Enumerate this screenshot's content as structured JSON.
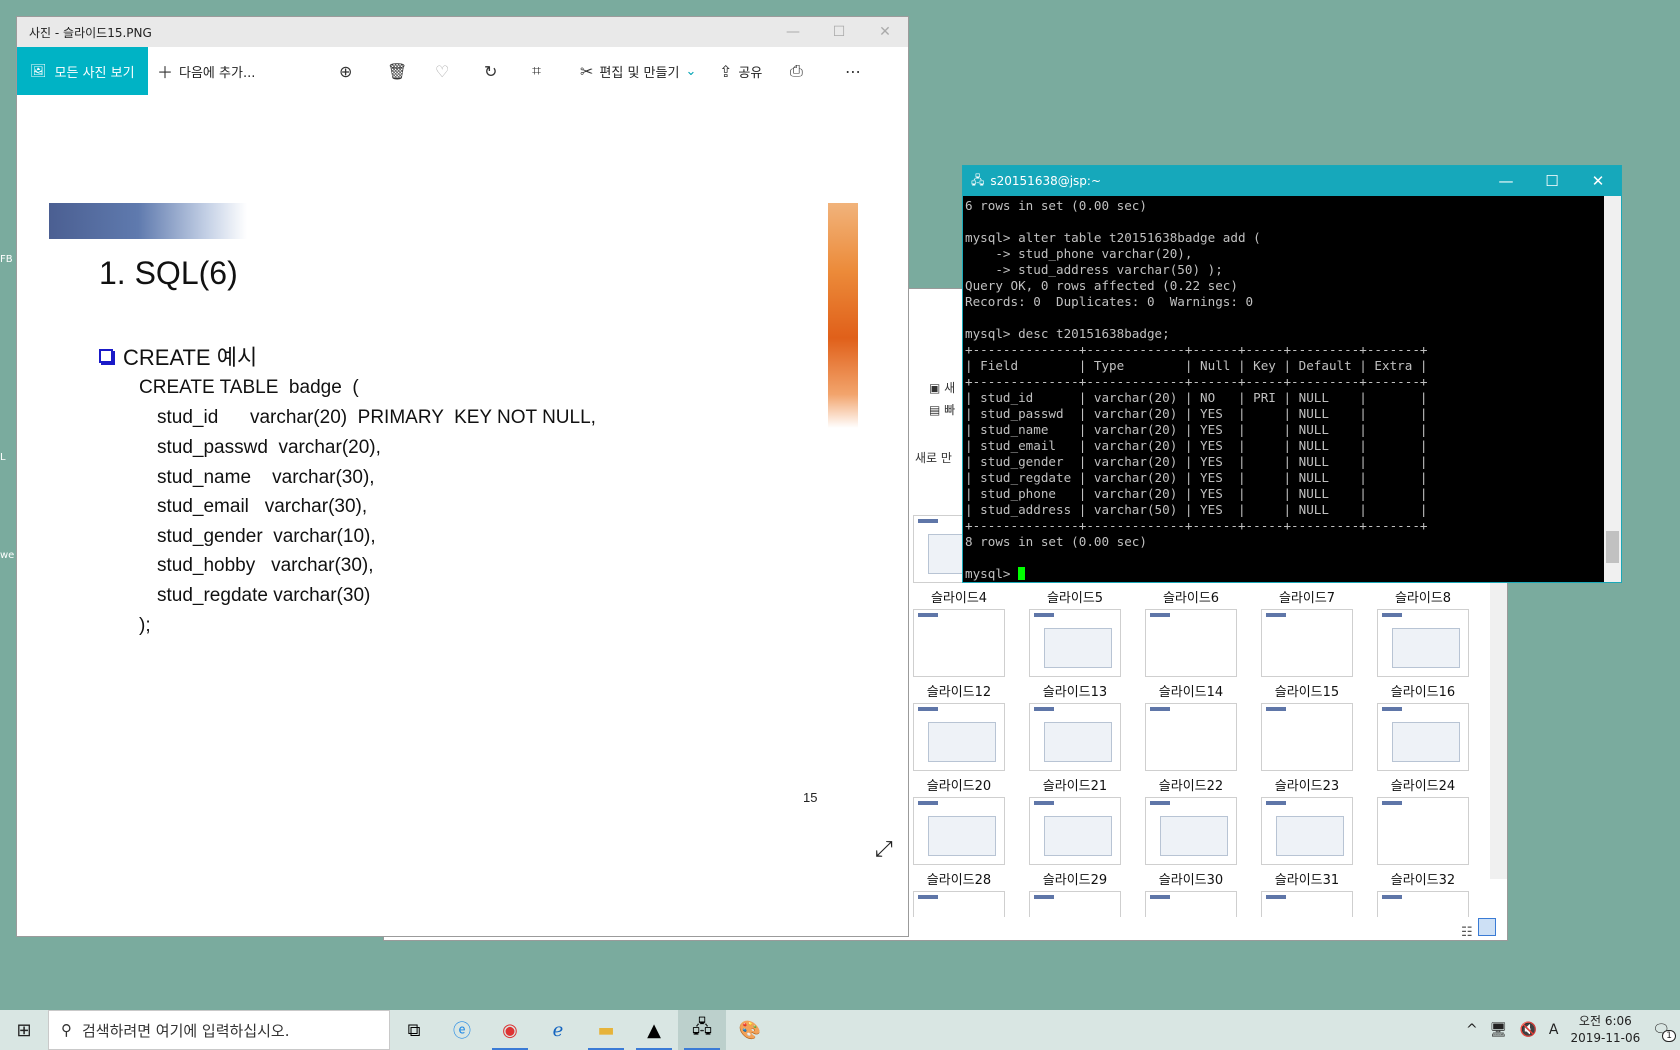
{
  "desktop": {
    "fragments": [
      "FB",
      "L",
      "we"
    ]
  },
  "explorer": {
    "ribbon": [
      "새",
      "빠",
      "새로 만"
    ],
    "rows": [
      [
        "슬라이드4",
        "슬라이드5",
        "슬라이드6",
        "슬라이드7",
        "슬라이드8"
      ],
      [
        "슬라이드12",
        "슬라이드13",
        "슬라이드14",
        "슬라이드15",
        "슬라이드16"
      ],
      [
        "슬라이드20",
        "슬라이드21",
        "슬라이드22",
        "슬라이드23",
        "슬라이드24"
      ],
      [
        "슬라이드28",
        "슬라이드29",
        "슬라이드30",
        "슬라이드31",
        "슬라이드32"
      ]
    ]
  },
  "photos": {
    "title": "사진 - 슬라이드15.PNG",
    "toolbar": {
      "all_photos": "모든 사진 보기",
      "add_to": "다음에 추가...",
      "edit_create": "편집 및 만들기",
      "share": "공유"
    },
    "slide": {
      "title": "1. SQL(6)",
      "bullet": "CREATE 예시",
      "code": [
        "CREATE TABLE  badge  (",
        "stud_id      varchar(20)  PRIMARY  KEY NOT NULL,",
        "stud_passwd  varchar(20),",
        "stud_name    varchar(30),",
        "stud_email   varchar(30),",
        "stud_gender  varchar(10),",
        "stud_hobby   varchar(30),",
        "stud_regdate varchar(30)",
        ");"
      ],
      "page": "15"
    }
  },
  "putty": {
    "title": "s20151638@jsp:~",
    "lines": [
      "6 rows in set (0.00 sec)",
      "",
      "mysql> alter table t20151638badge add (",
      "    -> stud_phone varchar(20),",
      "    -> stud_address varchar(50) );",
      "Query OK, 0 rows affected (0.22 sec)",
      "Records: 0  Duplicates: 0  Warnings: 0",
      "",
      "mysql> desc t20151638badge;",
      "+--------------+-------------+------+-----+---------+-------+",
      "| Field        | Type        | Null | Key | Default | Extra |",
      "+--------------+-------------+------+-----+---------+-------+",
      "| stud_id      | varchar(20) | NO   | PRI | NULL    |       |",
      "| stud_passwd  | varchar(20) | YES  |     | NULL    |       |",
      "| stud_name    | varchar(20) | YES  |     | NULL    |       |",
      "| stud_email   | varchar(20) | YES  |     | NULL    |       |",
      "| stud_gender  | varchar(20) | YES  |     | NULL    |       |",
      "| stud_regdate | varchar(20) | YES  |     | NULL    |       |",
      "| stud_phone   | varchar(20) | YES  |     | NULL    |       |",
      "| stud_address | varchar(50) | YES  |     | NULL    |       |",
      "+--------------+-------------+------+-----+---------+-------+",
      "8 rows in set (0.00 sec)",
      ""
    ],
    "prompt": "mysql> "
  },
  "taskbar": {
    "search_placeholder": "검색하려면 여기에 입력하십시오.",
    "ime": "A",
    "time": "오전 6:06",
    "date": "2019-11-06",
    "notification_count": "1"
  }
}
